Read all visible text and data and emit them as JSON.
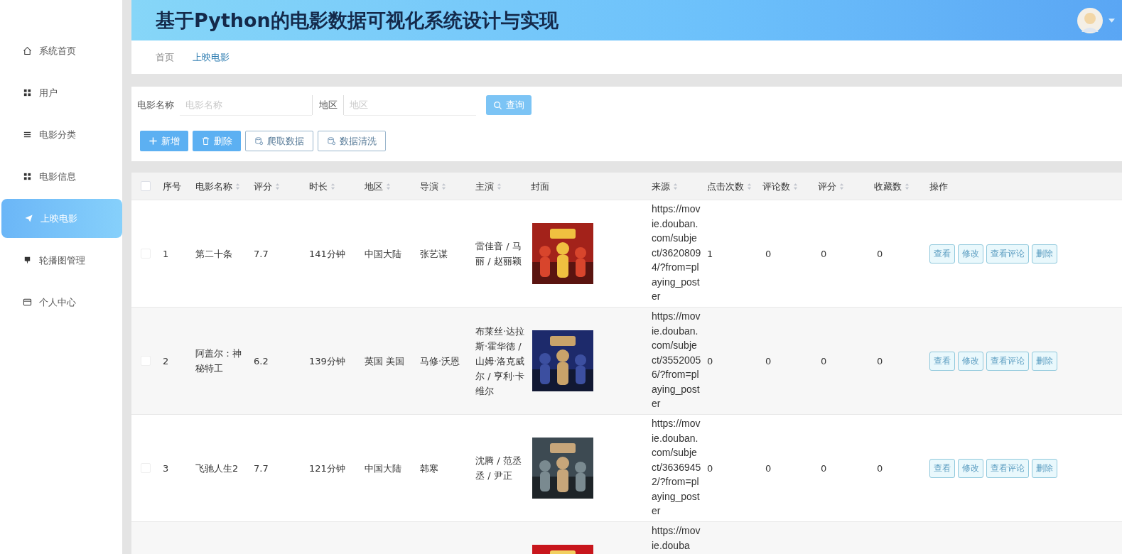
{
  "header": {
    "title": "基于Python的电影数据可视化系统设计与实现"
  },
  "sidebar": {
    "items": [
      {
        "label": "系统首页",
        "selected": false
      },
      {
        "label": "用户",
        "selected": false
      },
      {
        "label": "电影分类",
        "selected": false
      },
      {
        "label": "电影信息",
        "selected": false
      },
      {
        "label": "上映电影",
        "selected": true
      },
      {
        "label": "轮播图管理",
        "selected": false
      },
      {
        "label": "个人中心",
        "selected": false
      }
    ]
  },
  "breadcrumb": [
    {
      "label": "首页",
      "selected": false
    },
    {
      "label": "上映电影",
      "selected": true
    }
  ],
  "search": {
    "fields": [
      {
        "label": "电影名称",
        "placeholder": "电影名称"
      },
      {
        "label": "地区",
        "placeholder": "地区"
      }
    ],
    "button": "查询"
  },
  "toolbar": [
    {
      "label": "新增",
      "kind": "add"
    },
    {
      "label": "删除",
      "kind": "delete"
    },
    {
      "label": "爬取数据",
      "kind": "crawl"
    },
    {
      "label": "数据清洗",
      "kind": "clean"
    }
  ],
  "table": {
    "header_checked": false,
    "columns": [
      {
        "label": "序号",
        "sortable": false
      },
      {
        "label": "电影名称",
        "sortable": true
      },
      {
        "label": "评分",
        "sortable": true
      },
      {
        "label": "时长",
        "sortable": true
      },
      {
        "label": "地区",
        "sortable": true
      },
      {
        "label": "导演",
        "sortable": true
      },
      {
        "label": "主演",
        "sortable": true
      },
      {
        "label": "封面",
        "sortable": false
      },
      {
        "label": "来源",
        "sortable": true
      },
      {
        "label": "点击次数",
        "sortable": true
      },
      {
        "label": "评论数",
        "sortable": true
      },
      {
        "label": "评分",
        "sortable": true
      },
      {
        "label": "收藏数",
        "sortable": true
      },
      {
        "label": "操作",
        "sortable": false
      }
    ],
    "rows": [
      {
        "checked": false,
        "index": "1",
        "name": "第二十条",
        "rating": "7.7",
        "duration": "141分钟",
        "region": "中国大陆",
        "director": "张艺谋",
        "actors": "雷佳音 / 马丽 / 赵丽颖",
        "source": "https://movie.douban.com/subject/36208094/?from=playing_poster",
        "clicks": "1",
        "comments": "0",
        "score": "0",
        "favorites": "0",
        "actions": [
          "查看",
          "修改",
          "查看评论",
          "删除"
        ]
      },
      {
        "checked": false,
        "index": "2",
        "name": "阿盖尔：神秘特工",
        "rating": "6.2",
        "duration": "139分钟",
        "region": "英国 美国",
        "director": "马修·沃恩",
        "actors": "布莱丝·达拉斯·霍华德 / 山姆·洛克威尔 / 亨利·卡维尔",
        "source": "https://movie.douban.com/subject/35520056/?from=playing_poster",
        "clicks": "0",
        "comments": "0",
        "score": "0",
        "favorites": "0",
        "actions": [
          "查看",
          "修改",
          "查看评论",
          "删除"
        ]
      },
      {
        "checked": false,
        "index": "3",
        "name": "飞驰人生2",
        "rating": "7.7",
        "duration": "121分钟",
        "region": "中国大陆",
        "director": "韩寒",
        "actors": "沈腾 / 范丞丞 / 尹正",
        "source": "https://movie.douban.com/subject/36369452/?from=playing_poster",
        "clicks": "0",
        "comments": "0",
        "score": "0",
        "favorites": "0",
        "actions": [
          "查看",
          "修改",
          "查看评论",
          "删除"
        ]
      },
      {
        "source": "https://movie.douba"
      }
    ]
  }
}
